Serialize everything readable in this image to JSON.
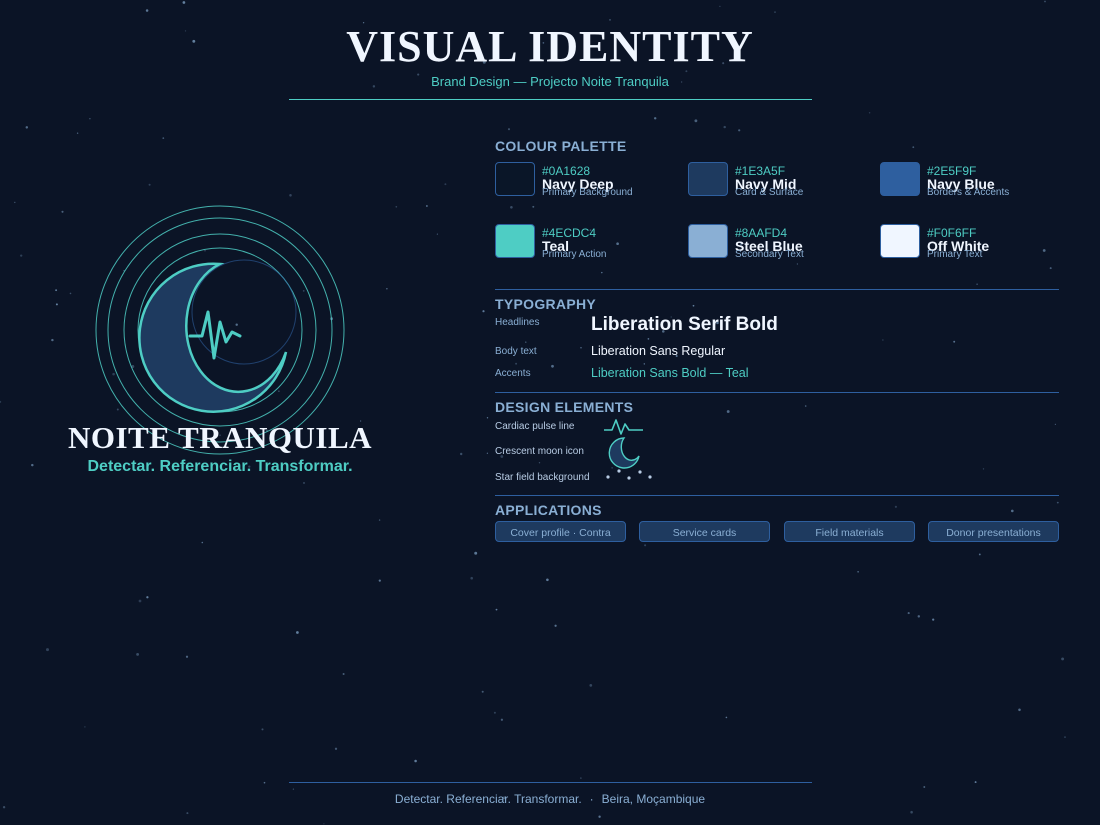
{
  "header": {
    "title": "VISUAL IDENTITY",
    "subtitle": "Brand Design — Projecto Noite Tranquila"
  },
  "brand": {
    "name": "NOITE TRANQUILA",
    "tagline": "Detectar. Referenciar. Transformar."
  },
  "palette": {
    "title": "COLOUR PALETTE",
    "swatches": [
      {
        "hex": "#0A1628",
        "name": "Navy Deep",
        "role": "Primary Background"
      },
      {
        "hex": "#1E3A5F",
        "name": "Navy Mid",
        "role": "Card & Surface"
      },
      {
        "hex": "#2E5F9F",
        "name": "Navy Blue",
        "role": "Borders & Accents"
      },
      {
        "hex": "#4ECDC4",
        "name": "Teal",
        "role": "Primary Action"
      },
      {
        "hex": "#8AAFD4",
        "name": "Steel Blue",
        "role": "Secondary Text"
      },
      {
        "hex": "#F0F6FF",
        "name": "Off White",
        "role": "Primary Text"
      }
    ]
  },
  "typography": {
    "title": "TYPOGRAPHY",
    "headlines_label": "Headlines",
    "headlines_sample": "Liberation Serif Bold",
    "body_label": "Body text",
    "body_sample": "Liberation Sans Regular",
    "accents_label": "Accents",
    "accents_sample": "Liberation Sans Bold — Teal"
  },
  "elements": {
    "title": "DESIGN ELEMENTS",
    "pulse_label": "Cardiac pulse line",
    "moon_label": "Crescent moon icon",
    "stars_label": "Star field background"
  },
  "applications": {
    "title": "APPLICATIONS",
    "items": [
      "Cover profile · Contra",
      "Service cards",
      "Field materials",
      "Donor presentations"
    ]
  },
  "footer": {
    "tagline": "Detectar. Referenciar. Transformar.",
    "separator": "·",
    "location": "Beira, Moçambique"
  },
  "colors": {
    "background": "#0A1628",
    "teal": "#4ECDC4",
    "navy_mid": "#1E3A5F",
    "navy_blue": "#2E5F9F",
    "steel_blue": "#8AAFD4",
    "off_white": "#F0F6FF"
  }
}
